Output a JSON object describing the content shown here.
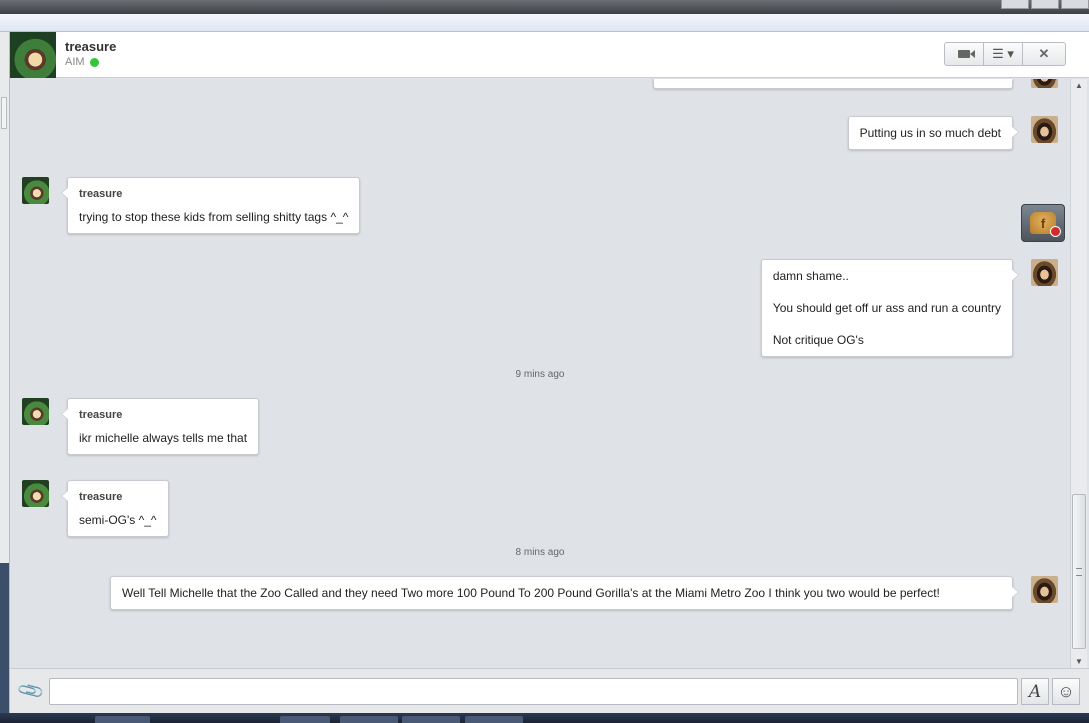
{
  "contact": {
    "name": "treasure",
    "service": "AIM",
    "status_color": "#33c53a"
  },
  "header_buttons": {
    "video_icon": "video-camera-icon",
    "menu_icon": "list-menu-icon",
    "close_label": "✕"
  },
  "messages": [
    {
      "direction": "out",
      "text": "Putting us in so much debt"
    },
    {
      "direction": "in",
      "sender": "treasure",
      "text": "trying to stop these kids from selling shitty tags ^_^"
    },
    {
      "direction": "out",
      "lines": [
        "damn shame..",
        "You should get off ur ass and run a country",
        "Not critique OG's"
      ]
    },
    {
      "timestamp": "9 mins ago"
    },
    {
      "direction": "in",
      "sender": "treasure",
      "text": "ikr michelle always tells me that"
    },
    {
      "direction": "in",
      "sender": "treasure",
      "text": "semi-OG's ^_^"
    },
    {
      "timestamp": "8 mins ago"
    },
    {
      "direction": "out",
      "text": "Well Tell Michelle that the Zoo Called and they need Two more 100 Pound To 200 Pound Gorilla's at the Miami Metro Zoo I think you two would be perfect!"
    }
  ],
  "widget": {
    "letter": "f"
  },
  "composer": {
    "placeholder": "",
    "format_label": "A",
    "emoji_label": "☺",
    "attach_label": "📎"
  },
  "colors": {
    "chat_background": "#dfe3e7",
    "bubble_background": "#ffffff",
    "online_green": "#33c53a"
  }
}
